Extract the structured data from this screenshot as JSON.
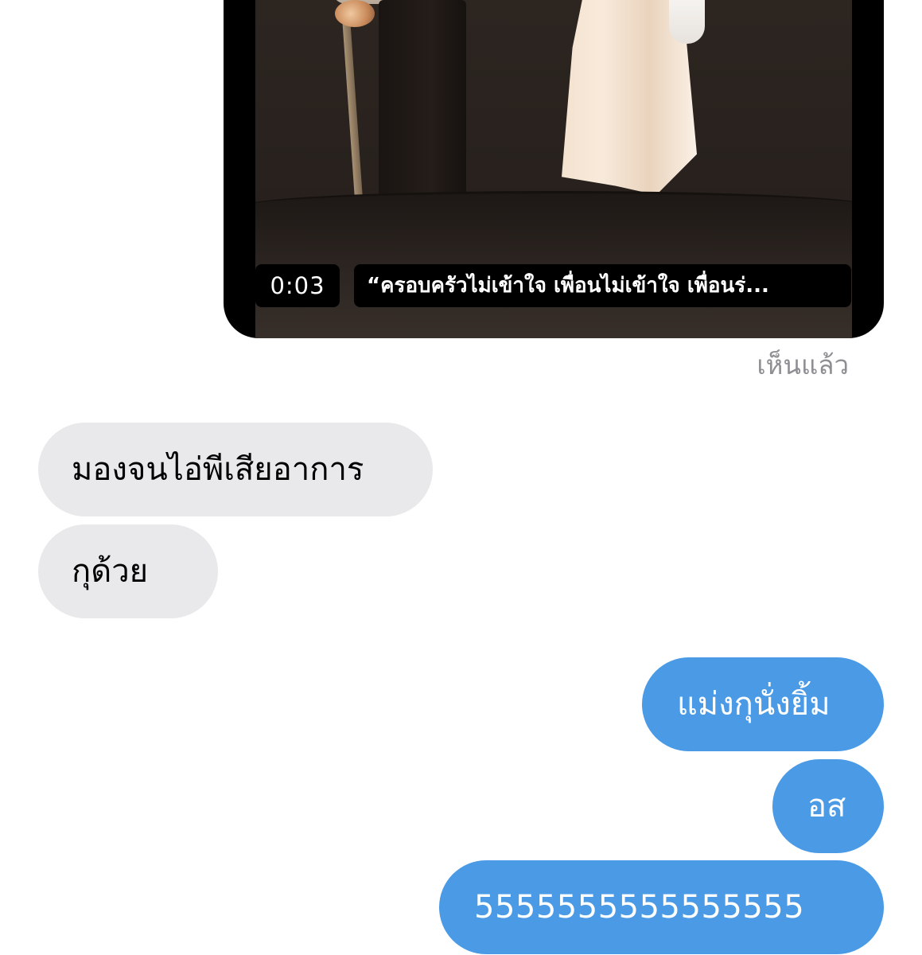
{
  "video_message": {
    "duration": "0:03",
    "caption": "“ครอบครัวไม่เข้าใจ เพื่อนไม่เข้าใจ เพื่อนร่..."
  },
  "read_receipt": "เห็นแล้ว",
  "messages": [
    {
      "direction": "incoming",
      "text": "มองจนไอ่พีเสียอาการ"
    },
    {
      "direction": "incoming",
      "text": "กุด้วย"
    },
    {
      "direction": "outgoing",
      "text": "แม่งกุนั่งยิ้ม"
    },
    {
      "direction": "outgoing",
      "text": "อส"
    },
    {
      "direction": "outgoing",
      "text": "5555555555555555"
    }
  ],
  "colors": {
    "incoming_bubble": "#e9e9eb",
    "outgoing_bubble": "#4b9ae5",
    "read_receipt": "#8e8e93"
  }
}
